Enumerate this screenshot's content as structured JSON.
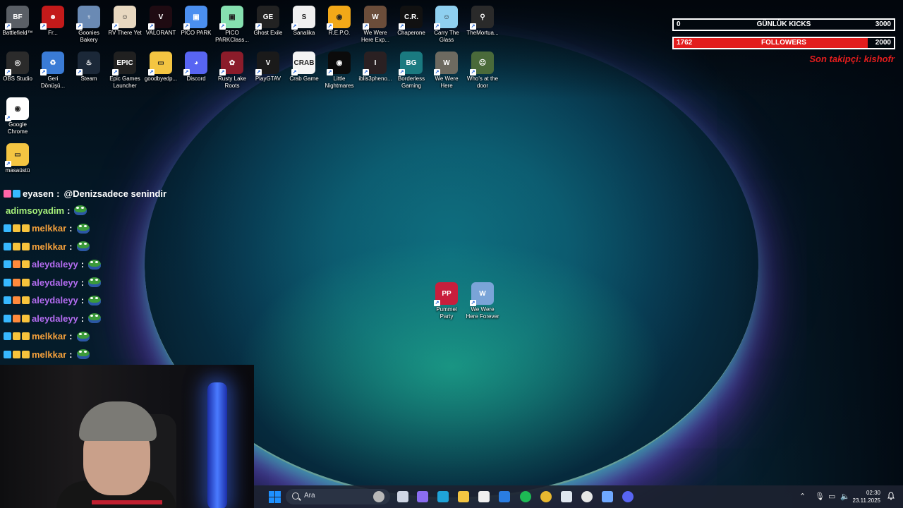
{
  "desktop_icons": [
    {
      "label": "Battlefield™",
      "color": "#5a5f66",
      "glyph": "BF"
    },
    {
      "label": "Fr...",
      "color": "#c31a1a",
      "glyph": "☻"
    },
    {
      "label": "Goonies Bakery",
      "color": "#6a8ab4",
      "glyph": "♀"
    },
    {
      "label": "RV There Yet",
      "color": "#e8d8c0",
      "glyph": "☺"
    },
    {
      "label": "VALORANT",
      "color": "#1f0b12",
      "glyph": "V"
    },
    {
      "label": "PICO PARK",
      "color": "#4b8ff0",
      "glyph": "▣"
    },
    {
      "label": "PICO PARKClass...",
      "color": "#86e0b0",
      "glyph": "▣"
    },
    {
      "label": "Ghost Exile",
      "color": "#222222",
      "glyph": "GE"
    },
    {
      "label": "Sanalika",
      "color": "#f0f0f0",
      "glyph": "S"
    },
    {
      "label": "R.E.P.O.",
      "color": "#f2a818",
      "glyph": "◉"
    },
    {
      "label": "We Were Here Exp...",
      "color": "#6b4d3a",
      "glyph": "W"
    },
    {
      "label": "Chaperone",
      "color": "#111111",
      "glyph": "C.R."
    },
    {
      "label": "Carry The Glass",
      "color": "#8fd0f0",
      "glyph": "☺"
    },
    {
      "label": "TheMortua...",
      "color": "#2a2a2a",
      "glyph": "⚲"
    },
    {
      "label": "OBS Studio",
      "color": "#2b2b2b",
      "glyph": "◎"
    },
    {
      "label": "Geri Dönüşü...",
      "color": "#3a7bd5",
      "glyph": "♻"
    },
    {
      "label": "Steam",
      "color": "#1b2838",
      "glyph": "♨"
    },
    {
      "label": "Epic Games Launcher",
      "color": "#202020",
      "glyph": "EPIC"
    },
    {
      "label": "goodbyedp...",
      "color": "#f4c542",
      "glyph": "▭"
    },
    {
      "label": "Discord",
      "color": "#5865f2",
      "glyph": "◕"
    },
    {
      "label": "Rusty Lake Roots",
      "color": "#8b1c2a",
      "glyph": "✿"
    },
    {
      "label": "PlayGTAV",
      "color": "#1a1a1a",
      "glyph": "V"
    },
    {
      "label": "Crab Game",
      "color": "#f4f4f4",
      "glyph": "CRAB"
    },
    {
      "label": "Little Nightmares",
      "color": "#0b0b0b",
      "glyph": "◉"
    },
    {
      "label": "iblis3pheno...",
      "color": "#2a2022",
      "glyph": "I"
    },
    {
      "label": "Borderless Gaming",
      "color": "#1a7a80",
      "glyph": "BG"
    },
    {
      "label": "We Were Here",
      "color": "#6d6a60",
      "glyph": "W"
    },
    {
      "label": "Who's at the door",
      "color": "#4a6a3a",
      "glyph": "☹"
    },
    {
      "label": "Google Chrome",
      "color": "#ffffff",
      "glyph": "◉"
    },
    {
      "label": "masaüstü",
      "color": "#f4c542",
      "glyph": "▭"
    },
    {
      "label": "Pummel Party",
      "color": "#c81e3c",
      "glyph": "PP"
    },
    {
      "label": "We Were Here Forever",
      "color": "#7aa4d8",
      "glyph": "W"
    }
  ],
  "overlay": {
    "kicks": {
      "left": "0",
      "label": "GÜNLÜK KICKS",
      "right": "3000",
      "progress": 0.0
    },
    "followers": {
      "left": "1762",
      "label": "FOLLOWERS",
      "right": "2000",
      "progress": 0.881
    },
    "last_follower": "Son takipçi: kishofr"
  },
  "chat": [
    {
      "user": "eyasen",
      "text": "@Denizsadece senindir",
      "color": "#ffffff",
      "badges": [
        "#ff66aa",
        "#37b8ff"
      ]
    },
    {
      "user": "adimsoyadim",
      "text": "",
      "color": "#a6f07a",
      "badges": []
    },
    {
      "user": "melkkar",
      "text": "",
      "color": "#f7a23c",
      "badges": [
        "#37b8ff",
        "#f7c33c",
        "#f7c33c"
      ]
    },
    {
      "user": "melkkar",
      "text": "",
      "color": "#f7a23c",
      "badges": [
        "#37b8ff",
        "#f7c33c",
        "#f7c33c"
      ]
    },
    {
      "user": "aleydaleyy",
      "text": "",
      "color": "#b36cf0",
      "badges": [
        "#37b8ff",
        "#ff8a3c",
        "#f7c33c"
      ]
    },
    {
      "user": "aleydaleyy",
      "text": "",
      "color": "#b36cf0",
      "badges": [
        "#37b8ff",
        "#ff8a3c",
        "#f7c33c"
      ]
    },
    {
      "user": "aleydaleyy",
      "text": "",
      "color": "#b36cf0",
      "badges": [
        "#37b8ff",
        "#ff8a3c",
        "#f7c33c"
      ]
    },
    {
      "user": "aleydaleyy",
      "text": "",
      "color": "#b36cf0",
      "badges": [
        "#37b8ff",
        "#ff8a3c",
        "#f7c33c"
      ]
    },
    {
      "user": "melkkar",
      "text": "",
      "color": "#f7a23c",
      "badges": [
        "#37b8ff",
        "#f7c33c",
        "#f7c33c"
      ]
    },
    {
      "user": "melkkar",
      "text": "",
      "color": "#f7a23c",
      "badges": [
        "#37b8ff",
        "#f7c33c",
        "#f7c33c"
      ]
    }
  ],
  "taskbar": {
    "search_placeholder": "Ara",
    "apps": [
      {
        "name": "task-view-icon",
        "color": "#cfd6e4"
      },
      {
        "name": "copilot-icon",
        "color": "#8a6cf0"
      },
      {
        "name": "edge-icon",
        "color": "#1fa3d8"
      },
      {
        "name": "file-explorer-icon",
        "color": "#f4c542"
      },
      {
        "name": "store-icon",
        "color": "#f0f0f0"
      },
      {
        "name": "mail-icon",
        "color": "#2a7de1"
      },
      {
        "name": "spotify-icon",
        "color": "#1db954"
      },
      {
        "name": "chrome-icon",
        "color": "#e8b830"
      },
      {
        "name": "steam-icon",
        "color": "#dfe6ef"
      },
      {
        "name": "obs-icon",
        "color": "#e6e6e6"
      },
      {
        "name": "app-icon",
        "color": "#6fa8ff"
      },
      {
        "name": "discord-icon",
        "color": "#5865f2"
      }
    ],
    "time": "02:30",
    "date": "23.11.2025"
  }
}
